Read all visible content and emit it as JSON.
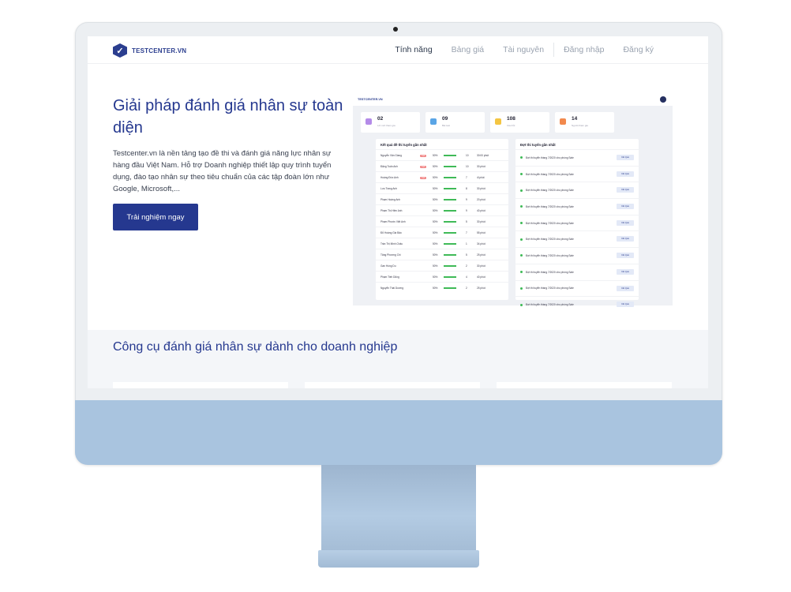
{
  "brand": {
    "logo_text": "TESTCENTER.VN",
    "accent": "#25388f"
  },
  "nav": {
    "items": [
      "Tính năng",
      "Bảng giá",
      "Tài nguyên",
      "Đăng nhập",
      "Đăng ký"
    ],
    "active_index": 0
  },
  "hero": {
    "title": "Giải pháp đánh giá nhân sự toàn diện",
    "description": "Testcenter.vn là nền tảng tạo đề thi và đánh giá năng lực nhân sự hàng đầu Việt Nam. Hỗ trợ Doanh nghiệp thiết lập quy trình tuyển dụng, đào tạo nhân sự theo tiêu chuẩn của các tập đoàn lớn như Google, Microsoft,...",
    "cta_label": "Trải nghiệm ngay"
  },
  "dashboard": {
    "stats": [
      {
        "value": "02",
        "label": "Lời mời tham gia",
        "color": "#b48be8"
      },
      {
        "value": "09",
        "label": "Bài test",
        "color": "#5aa5e6"
      },
      {
        "value": "108",
        "label": "Câu hỏi",
        "color": "#f4c542"
      },
      {
        "value": "14",
        "label": "Người tham gia",
        "color": "#f2894d"
      }
    ],
    "results_title": "Kết quả đề thi tuyển gần nhất",
    "results_rows": [
      {
        "name": "Nguyễn Văn Giang",
        "pct": "50%",
        "n": "10",
        "t": "30:00 phút",
        "tag": "Fail"
      },
      {
        "name": "Đặng Tuấn Anh",
        "pct": "50%",
        "n": "10",
        "t": "30 phút",
        "tag": "Fail"
      },
      {
        "name": "Hoàng Đức Anh",
        "pct": "50%",
        "n": "7",
        "t": "4l phút",
        "tag": "Fail"
      },
      {
        "name": "Lưu Trang Anh",
        "pct": "50%",
        "n": "8",
        "t": "30 phút",
        "tag": ""
      },
      {
        "name": "Phạm Hoàng Anh",
        "pct": "50%",
        "n": "9",
        "t": "20 phút",
        "tag": ""
      },
      {
        "name": "Phạm Thị Hiền Anh",
        "pct": "50%",
        "n": "9",
        "t": "40 phút",
        "tag": ""
      },
      {
        "name": "Phạm Phước Việt Anh",
        "pct": "50%",
        "n": "5",
        "t": "30 phút",
        "tag": ""
      },
      {
        "name": "Đỗ Hoàng Gia Bảo",
        "pct": "50%",
        "n": "7",
        "t": "55 phút",
        "tag": ""
      },
      {
        "name": "Trần Thị Minh Châu",
        "pct": "50%",
        "n": "1",
        "t": "34 phút",
        "tag": ""
      },
      {
        "name": "Tăng Phương Chi",
        "pct": "50%",
        "n": "5",
        "t": "25 phút",
        "tag": ""
      },
      {
        "name": "Gan Hùng Du",
        "pct": "50%",
        "n": "2",
        "t": "30 phút",
        "tag": ""
      },
      {
        "name": "Phạm Tiến Dũng",
        "pct": "50%",
        "n": "4",
        "t": "40 phút",
        "tag": ""
      },
      {
        "name": "Nguyễn Thái Dương",
        "pct": "50%",
        "n": "2",
        "t": "25 phút",
        "tag": ""
      }
    ],
    "recent_title": "Đợt thi tuyển gần nhất",
    "recent_item": "Đợt thi tuyển tháng 7/2020 cho phòng Sale",
    "recent_btn": "Kết Quả"
  },
  "section2": {
    "title": "Công cụ đánh giá nhân sự dành cho doanh nghiệp"
  }
}
